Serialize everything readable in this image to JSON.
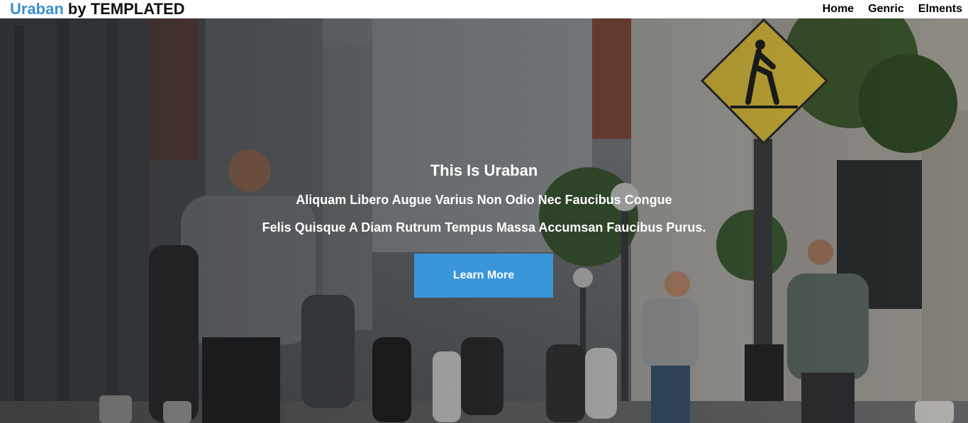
{
  "header": {
    "logo_brand": "Uraban",
    "logo_rest": " by TEMPLATED",
    "nav": [
      "Home",
      "Genric",
      "Elments"
    ]
  },
  "hero": {
    "title": "This Is Uraban",
    "subtitle_1": "Aliquam Libero Augue Varius Non Odio Nec Faucibus Congue",
    "subtitle_2": "Felis Quisque A Diam Rutrum Tempus Massa Accumsan Faucibus Purus.",
    "button_label": "Learn More"
  },
  "colors": {
    "accent": "#3a8fd0",
    "button": "#3a95db",
    "sign": "#e6c63a"
  }
}
